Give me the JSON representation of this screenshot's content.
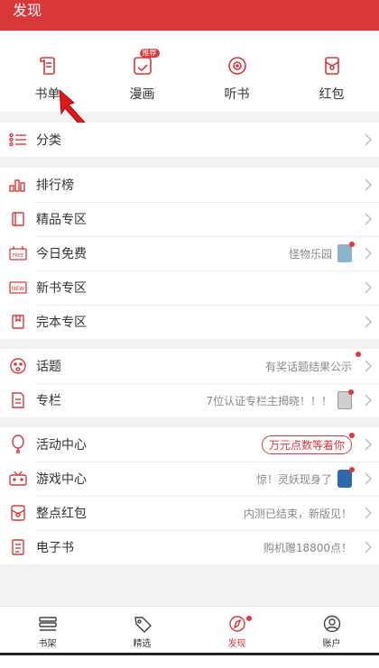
{
  "header": {
    "title": "发现"
  },
  "quick": [
    {
      "label": "书单",
      "icon": "book-list-icon"
    },
    {
      "label": "漫画",
      "icon": "comic-icon",
      "badge": "推荐"
    },
    {
      "label": "听书",
      "icon": "audio-book-icon"
    },
    {
      "label": "红包",
      "icon": "red-packet-icon"
    }
  ],
  "sections": {
    "category": [
      {
        "label": "分类"
      }
    ],
    "books": [
      {
        "label": "排行榜"
      },
      {
        "label": "精品专区"
      },
      {
        "label": "今日免费",
        "value": "怪物乐园"
      },
      {
        "label": "新书专区"
      },
      {
        "label": "完本专区"
      }
    ],
    "community": [
      {
        "label": "话题",
        "value": "有奖话题结果公示"
      },
      {
        "label": "专栏",
        "value": "7位认证专栏主揭晓！！！"
      }
    ],
    "activities": [
      {
        "label": "活动中心",
        "value": "万元点数等着你"
      },
      {
        "label": "游戏中心",
        "value": "惊！灵妖现身了"
      },
      {
        "label": "整点红包",
        "value": "内测已结束，新版见！"
      },
      {
        "label": "电子书",
        "value": "购机赠18800点！"
      }
    ]
  },
  "tabs": [
    {
      "label": "书架"
    },
    {
      "label": "精选"
    },
    {
      "label": "发现"
    },
    {
      "label": "账户"
    }
  ],
  "colors": {
    "accent": "#d9383a",
    "background": "#f2f2f2"
  }
}
